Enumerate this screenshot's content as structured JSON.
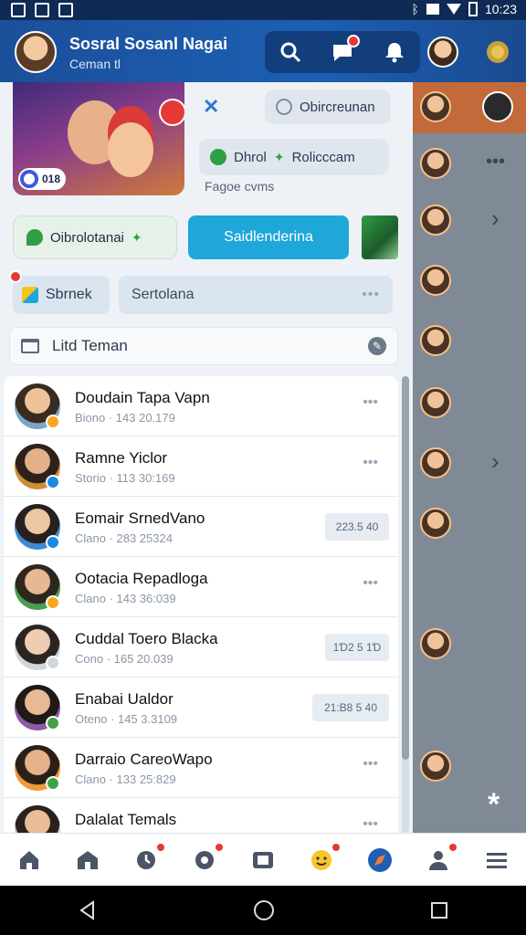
{
  "status_bar": {
    "time": "10:23"
  },
  "header": {
    "title": "Sosral Sosanl Nagai",
    "subtitle": "Ceman  tl"
  },
  "promo": {
    "tag": "018"
  },
  "top_buttons": {
    "pill_1": "Obircreunan",
    "pill_2": "Dhrol",
    "pill_2_suffix": "Rolicccam",
    "pages_label": "Fagoe cvms",
    "light_button": "Oibrolotanai",
    "primary_button": "Saidlenderina"
  },
  "filters": {
    "chip": "Sbrnek",
    "search_value": "Sertolana",
    "search_more": "•••"
  },
  "list_header": {
    "label": "Litd Teman"
  },
  "contacts": [
    {
      "name": "Doudain Tapa Vapn",
      "meta": "Biono · 143 20.179",
      "action": "•••",
      "badge_color": "#f5a623"
    },
    {
      "name": "Ramne Yiclor",
      "meta": "Storio · 113 30:169",
      "action": "•••",
      "badge_color": "#1e88e5"
    },
    {
      "name": "Eomair SrnedVano",
      "meta": "Clano · 283 25324",
      "action_pill": "223.5 40",
      "badge_color": "#1e88e5"
    },
    {
      "name": "Ootacia Repadloga",
      "meta": "Clano · 143 36:039",
      "action": "•••",
      "badge_color": "#f5a623"
    },
    {
      "name": "Cuddal Toero Blacka",
      "meta": "Cono · 165 20.039",
      "action_pill": "1Ɗ2 5 1Ɗ",
      "badge_color": "#cfd6dc"
    },
    {
      "name": "Enabai Ualdor",
      "meta": "Oteno · 145 3.3109",
      "action_pill": "21:B8 5 40",
      "badge_color": "#43a047"
    },
    {
      "name": "Darraio CareoWapo",
      "meta": "Clano · 133 25:829",
      "action": "•••",
      "badge_color": "#43a047"
    },
    {
      "name": "Dalalat Temals",
      "meta": "",
      "action": "•••",
      "badge_color": "#1e88e5"
    }
  ],
  "colors": {
    "header_bg": "#1c5fb3",
    "primary": "#1ea7d8",
    "badge": "#e53935"
  }
}
